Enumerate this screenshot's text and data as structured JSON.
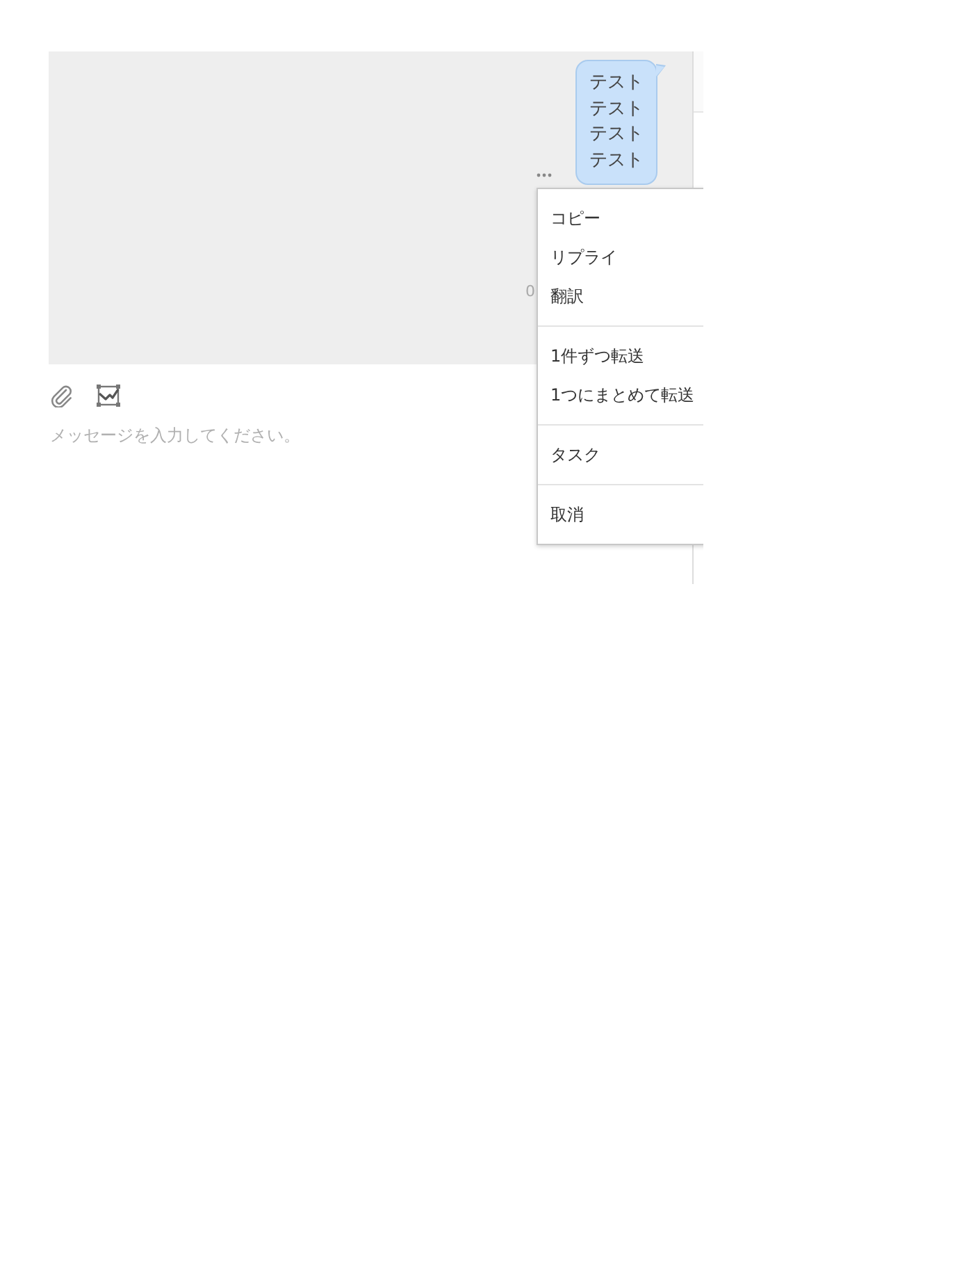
{
  "messages": [
    {
      "kind": "outgoing",
      "text": "テストテストテストテスト",
      "time": "0"
    }
  ],
  "context_menu": {
    "groups": [
      {
        "items": [
          {
            "label": "コピー"
          },
          {
            "label": "リプライ"
          },
          {
            "label": "翻訳"
          }
        ]
      },
      {
        "items": [
          {
            "label": "1件ずつ転送"
          },
          {
            "label": "1つにまとめて転送"
          }
        ]
      },
      {
        "items": [
          {
            "label": "タスク"
          }
        ]
      },
      {
        "items": [
          {
            "label": "取消"
          }
        ]
      }
    ]
  },
  "composer": {
    "placeholder": "メッセージを入力してください。"
  }
}
